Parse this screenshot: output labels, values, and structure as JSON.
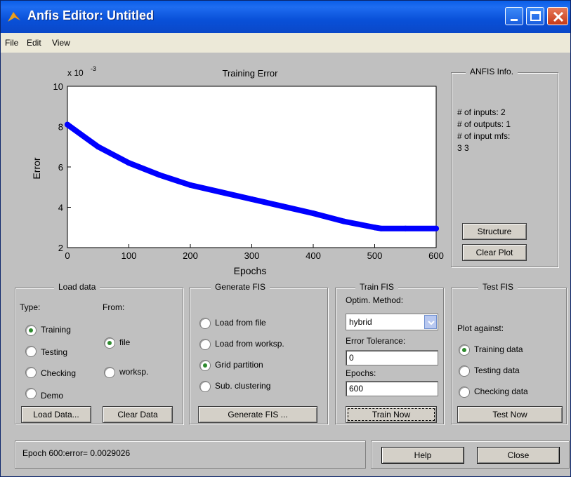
{
  "window": {
    "title": "Anfis Editor: Untitled"
  },
  "menu": {
    "items": [
      "File",
      "Edit",
      "View"
    ]
  },
  "plot": {
    "title": "Training Error",
    "xlabel": "Epochs",
    "ylabel": "Error",
    "exponent_prefix": "x 10",
    "exponent": "-3",
    "x_ticks": [
      "0",
      "100",
      "200",
      "300",
      "400",
      "500",
      "600"
    ],
    "y_ticks": [
      "2",
      "4",
      "6",
      "8",
      "10"
    ]
  },
  "chart_data": {
    "type": "line",
    "title": "Training Error",
    "xlabel": "Epochs",
    "ylabel": "Error",
    "y_scale_note": "x 10^-3",
    "xlim": [
      0,
      600
    ],
    "ylim": [
      2,
      10
    ],
    "x": [
      0,
      50,
      100,
      150,
      200,
      250,
      300,
      350,
      400,
      450,
      500,
      510,
      550,
      600
    ],
    "y": [
      8.1,
      7.0,
      6.2,
      5.6,
      5.1,
      4.75,
      4.4,
      4.05,
      3.7,
      3.3,
      3.0,
      2.95,
      2.95,
      2.95
    ],
    "color": "#0000ff"
  },
  "info": {
    "frame_title": "ANFIS Info.",
    "lines": [
      "# of inputs: 2",
      "# of outputs: 1",
      "# of input mfs:",
      "3  3"
    ],
    "structure_label": "Structure",
    "clear_plot_label": "Clear Plot"
  },
  "load_data": {
    "frame_title": "Load data",
    "type_label": "Type:",
    "from_label": "From:",
    "types": [
      "Training",
      "Testing",
      "Checking",
      "Demo"
    ],
    "from_opts": [
      "file",
      "worksp."
    ],
    "load_button": "Load Data...",
    "clear_button": "Clear Data"
  },
  "generate_fis": {
    "frame_title": "Generate FIS",
    "options": [
      "Load from file",
      "Load from worksp.",
      "Grid partition",
      "Sub. clustering"
    ],
    "button": "Generate FIS ..."
  },
  "train_fis": {
    "frame_title": "Train FIS",
    "method_label": "Optim. Method:",
    "method_value": "hybrid",
    "tolerance_label": "Error Tolerance:",
    "tolerance_value": "0",
    "epochs_label": "Epochs:",
    "epochs_value": "600",
    "button": "Train Now"
  },
  "test_fis": {
    "frame_title": "Test FIS",
    "plot_against_label": "Plot against:",
    "options": [
      "Training data",
      "Testing data",
      "Checking data"
    ],
    "button": "Test Now"
  },
  "status": {
    "text": "Epoch 600:error= 0.0029026"
  },
  "footer": {
    "help_label": "Help",
    "close_label": "Close"
  }
}
